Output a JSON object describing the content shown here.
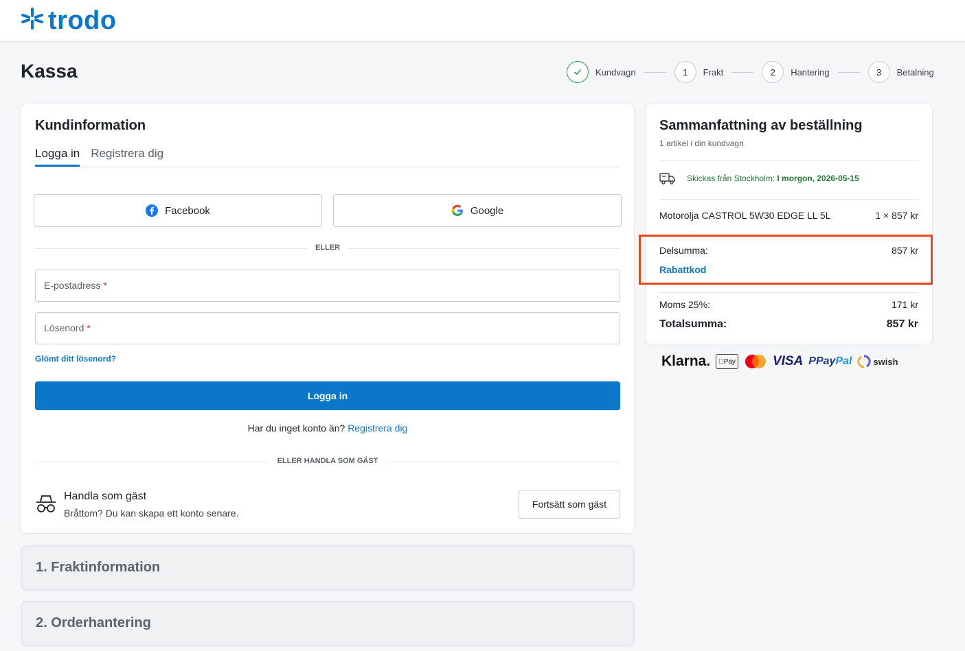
{
  "header": {
    "logo_text": "trodo",
    "brand_color": "#0a77c9"
  },
  "page_title": "Kassa",
  "stepper": [
    {
      "number": "",
      "label": "Kundvagn",
      "state": "done"
    },
    {
      "number": "1",
      "label": "Frakt",
      "state": "pending"
    },
    {
      "number": "2",
      "label": "Hantering",
      "state": "pending"
    },
    {
      "number": "3",
      "label": "Betalning",
      "state": "pending"
    }
  ],
  "customer": {
    "title": "Kundinformation",
    "tabs": [
      "Logga in",
      "Registrera dig"
    ],
    "facebook_label": "Facebook",
    "google_label": "Google",
    "or_label": "ELLER",
    "email_placeholder": "E-postadress",
    "password_placeholder": "Lösenord",
    "required_mark": "*",
    "forgot_label": "Glömt ditt lösenord?",
    "login_button": "Logga in",
    "no_account_text": "Har du inget konto än?",
    "register_link": "Registrera dig",
    "guest_divider": "ELLER HANDLA SOM GÄST",
    "guest_title": "Handla som gäst",
    "guest_sub": "Bråttom? Du kan skapa ett konto senare.",
    "guest_button": "Fortsätt som gäst"
  },
  "sections": [
    {
      "label": "1. Fraktinformation"
    },
    {
      "label": "2. Orderhantering"
    }
  ],
  "summary": {
    "title": "Sammanfattning av beställning",
    "subtitle": "1 artikel i din kundvagn",
    "shipping_prefix": "Skickas från Stockholm:",
    "shipping_date": "I morgon, 2026-05-15",
    "item_name": "Motorolja CASTROL 5W30 EDGE LL 5L",
    "item_qty_price": "1 × 857 kr",
    "subtotal_label": "Delsumma:",
    "subtotal_value": "857 kr",
    "discount_label": "Rabattkod",
    "vat_label": "Moms 25%:",
    "vat_value": "171 kr",
    "total_label": "Totalsumma:",
    "total_value": "857 kr",
    "highlight_color": "#e8471c"
  },
  "payments": {
    "klarna": "Klarna.",
    "applepay": "Pay",
    "visa": "VISA",
    "paypal_1": "Pay",
    "paypal_2": "Pal",
    "swish": "swish"
  }
}
